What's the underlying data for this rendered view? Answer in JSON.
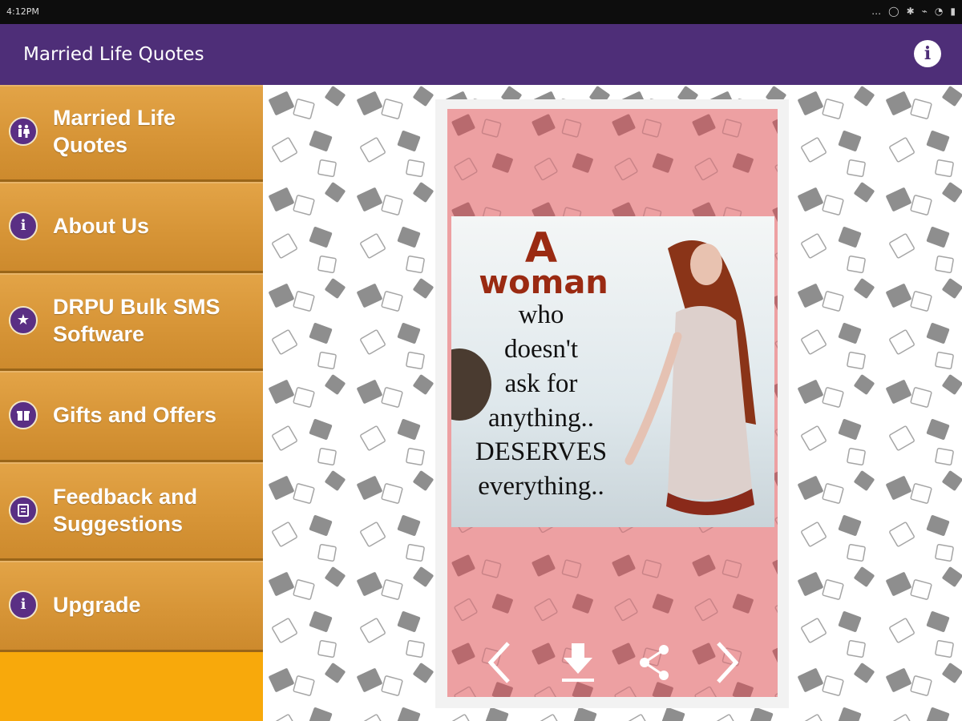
{
  "status_bar": {
    "time": "4:12PM",
    "icons": [
      "more-dots-icon",
      "alarm-icon",
      "bluetooth-icon",
      "signal-icon",
      "wifi-icon",
      "battery-icon"
    ]
  },
  "app_bar": {
    "title": "Married Life Quotes",
    "info_icon": "info-icon"
  },
  "drawer": {
    "items": [
      {
        "label": "Married Life Quotes",
        "lines": [
          "Married Life",
          "Quotes"
        ],
        "icon": "couple-icon"
      },
      {
        "label": "About Us",
        "lines": [
          "About Us"
        ],
        "icon": "info-icon"
      },
      {
        "label": "DRPU Bulk SMS Software",
        "lines": [
          "DRPU Bulk SMS",
          "Software"
        ],
        "icon": "star-icon"
      },
      {
        "label": "Gifts and Offers",
        "lines": [
          "Gifts and Offers"
        ],
        "icon": "gift-icon"
      },
      {
        "label": "Feedback and Suggestions",
        "lines": [
          "Feedback and",
          "Suggestions"
        ],
        "icon": "feedback-icon"
      },
      {
        "label": "Upgrade",
        "lines": [
          "Upgrade"
        ],
        "icon": "info-icon"
      }
    ]
  },
  "quote_card": {
    "lines": [
      "A",
      "woman",
      "who",
      "doesn't",
      "ask for",
      "anything..",
      "DESERVES",
      "everything.."
    ],
    "controls": [
      "previous-icon",
      "download-icon",
      "share-icon",
      "next-icon"
    ]
  },
  "colors": {
    "app_bar": "#4e2e78",
    "drawer_background": "#f8a90b",
    "drawer_item": "#d79537",
    "card_background": "#eda0a2",
    "quote_accent": "#9a2a12"
  }
}
